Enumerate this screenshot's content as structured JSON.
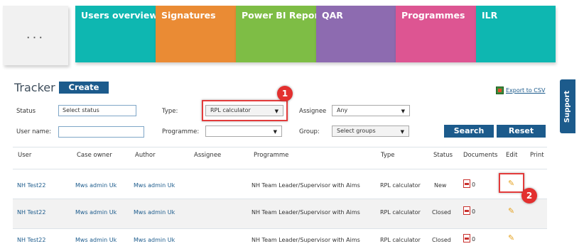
{
  "menu": {
    "dots": "..."
  },
  "nav": [
    {
      "label": "Users overview",
      "color": "#0eb7b1"
    },
    {
      "label": "Signatures",
      "color": "#ea8b34"
    },
    {
      "label": "Power BI Reports",
      "color": "#7ebd45"
    },
    {
      "label": "QAR",
      "color": "#8d6bb0"
    },
    {
      "label": "Programmes",
      "color": "#dd5592"
    },
    {
      "label": "ILR",
      "color": "#0eb7b1"
    }
  ],
  "header": {
    "title": "Tracker",
    "create": "Create",
    "export": "Export to CSV",
    "support": "Support"
  },
  "filters": {
    "status_label": "Status",
    "status_value": "Select status",
    "type_label": "Type:",
    "type_value": "RPL calculator",
    "assignee_label": "Assignee",
    "assignee_value": "Any",
    "username_label": "User name:",
    "username_value": "",
    "programme_label": "Programme:",
    "programme_value": "",
    "group_label": "Group:",
    "group_value": "Select groups",
    "search": "Search",
    "reset": "Reset"
  },
  "annotations": {
    "step1": "1",
    "step2": "2",
    "highlight_color": "#e33b3b"
  },
  "table": {
    "columns": [
      "User",
      "Case owner",
      "Author",
      "Assignee",
      "Programme",
      "Type",
      "Status",
      "Documents",
      "Edit",
      "Print"
    ],
    "rows": [
      {
        "user": "NH Test22",
        "case_owner": "Mws admin Uk",
        "author": "Mws admin Uk",
        "assignee": "",
        "programme": "NH Team Leader/Supervisor with Aims",
        "type": "RPL calculator",
        "status": "New",
        "documents": "0"
      },
      {
        "user": "NH Test22",
        "case_owner": "Mws admin Uk",
        "author": "Mws admin Uk",
        "assignee": "",
        "programme": "NH Team Leader/Supervisor with Aims",
        "type": "RPL calculator",
        "status": "Closed",
        "documents": "0"
      },
      {
        "user": "NH Test22",
        "case_owner": "Mws admin Uk",
        "author": "Mws admin Uk",
        "assignee": "",
        "programme": "NH Team Leader/Supervisor with Aims",
        "type": "RPL calculator",
        "status": "Closed",
        "documents": "0"
      }
    ]
  },
  "icons": {
    "menu": "ellipsis-icon",
    "export": "excel-icon",
    "document": "pdf-icon",
    "edit": "pencil-icon",
    "dropdown": "caret-down-icon"
  }
}
